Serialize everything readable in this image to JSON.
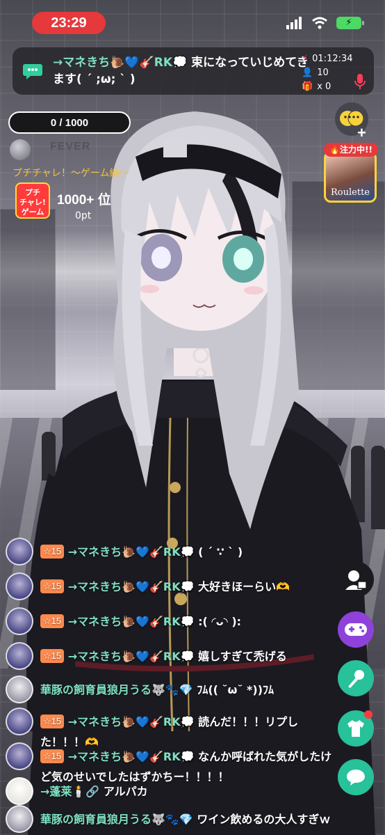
{
  "status_bar": {
    "time": "23:29",
    "battery_icon": "battery-charging-icon",
    "signal_icon": "cellular-signal-icon",
    "wifi_icon": "wifi-icon"
  },
  "banner": {
    "user": "→マネきち🐌💙🎸RK💭",
    "message": "束になっていじめてきます( ´ ;ω; ` )",
    "timer": "01:12:34",
    "viewers": "10",
    "gifts": "x 0"
  },
  "progress": {
    "label": "0 / 1000"
  },
  "fever": {
    "label": "FEVER"
  },
  "challenge": {
    "title": "プチチャレ！〜ゲーム編〜",
    "icon_text": "プチ\nチャレ!\nゲーム",
    "rank": "1000+ 位",
    "points": "0pt"
  },
  "side": {
    "roulette_tag": "🔥注力中!!",
    "roulette_label": "Roulette",
    "buttons": [
      "avatar-gift-icon",
      "gamepad-icon",
      "microphone-icon",
      "shirt-icon",
      "comment-icon"
    ]
  },
  "chat": [
    {
      "level": "15",
      "user": "→マネきち🐌💙🎸RK💭",
      "text": "( ´ ∵ ` )"
    },
    {
      "level": "15",
      "user": "→マネきち🐌💙🎸RK💭",
      "text": "大好きほーらい🫶"
    },
    {
      "level": "15",
      "user": "→マネきち🐌💙🎸RK💭",
      "text": ":( ◜ᴗ◝ ):"
    },
    {
      "level": "15",
      "user": "→マネきち🐌💙🎸RK💭",
      "text": "嬉しすぎて禿げる"
    },
    {
      "level": "",
      "user": "華豚の飼育員狼月うる🐺🐾💎",
      "text": "ﾌﾑ(( ˘ω˘ *))ﾌﾑ"
    },
    {
      "level": "15",
      "user": "→マネきち🐌💙🎸RK💭",
      "text": "読んだ！！！リプした！！！🫶"
    },
    {
      "level": "15",
      "user": "→マネきち🐌💙🎸RK💭",
      "text": "なんか呼ばれた気がしたけど気のせいでしたはずかちー！！！！"
    },
    {
      "level": "",
      "user": "→蓬莱🕯️🔗",
      "text": "アルパカ"
    },
    {
      "level": "",
      "user": "華豚の飼育員狼月うる🐺🐾💎",
      "text": "ワイン飲めるの大人すぎｗ"
    }
  ]
}
